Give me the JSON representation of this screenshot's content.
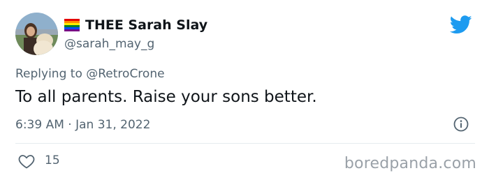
{
  "tweet": {
    "display_name": "THEE Sarah Slay",
    "handle": "@sarah_may_g",
    "replying_prefix": "Replying to ",
    "replying_to": "@RetroCrone",
    "text": "To all parents. Raise your sons better.",
    "timestamp": "6:39 AM · Jan 31, 2022",
    "like_count": "15"
  },
  "watermark": "boredpanda.com",
  "colors": {
    "twitter_blue": "#1d9bf0",
    "muted_text": "#536471",
    "primary_text": "#0f1419"
  },
  "icons": {
    "brand": "twitter-bird-icon",
    "flag": "rainbow-flag-icon",
    "info": "info-icon",
    "like": "heart-outline-icon"
  }
}
